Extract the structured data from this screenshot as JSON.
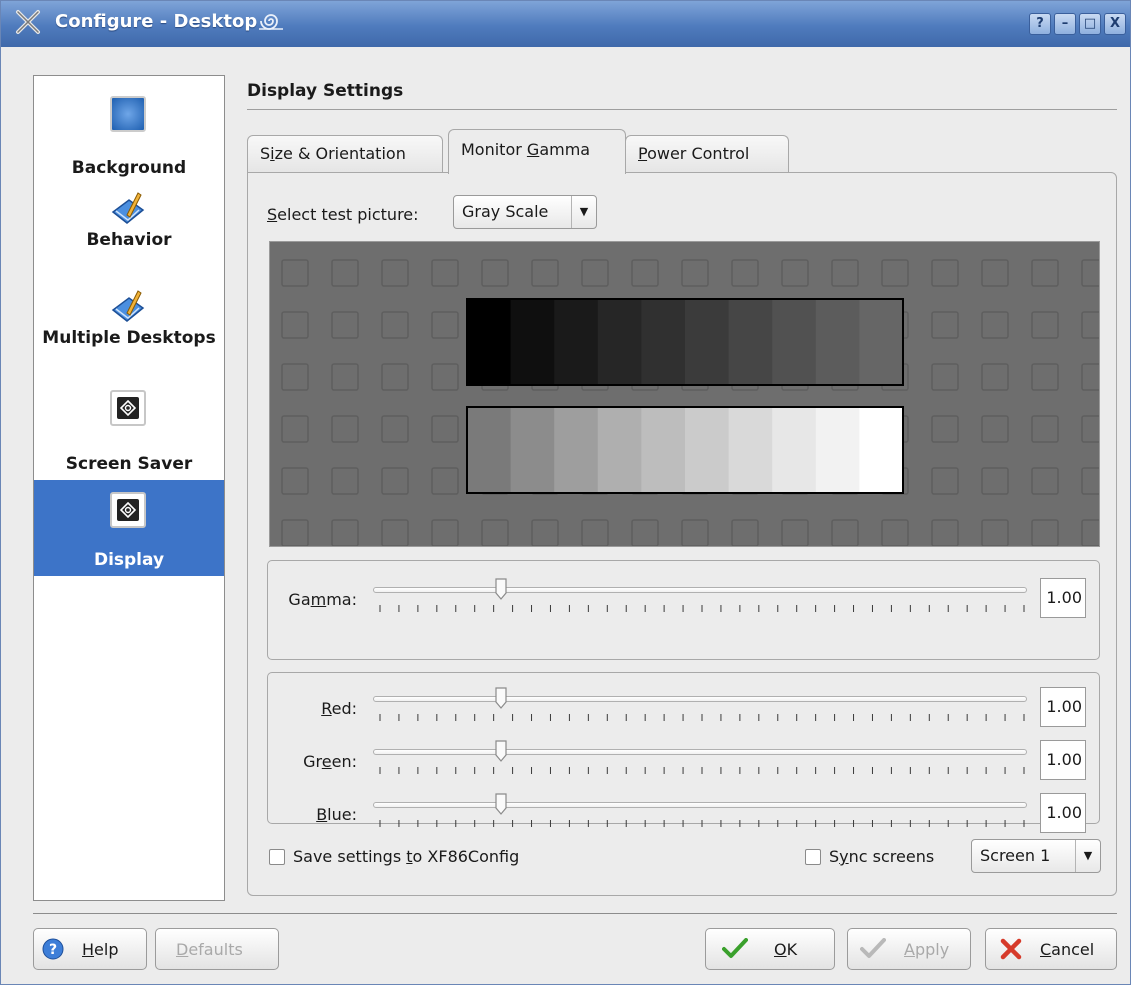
{
  "window": {
    "title": "Configure - Desktop"
  },
  "sidebar": {
    "items": [
      {
        "label": "Background",
        "icon": "background-icon",
        "selected": false
      },
      {
        "label": "Behavior",
        "icon": "behavior-icon",
        "selected": false
      },
      {
        "label": "Multiple Desktops",
        "icon": "multiple-desktops-icon",
        "selected": false
      },
      {
        "label": "Screen Saver",
        "icon": "screen-saver-icon",
        "selected": false
      },
      {
        "label": "Display",
        "icon": "display-icon",
        "selected": true
      }
    ]
  },
  "main": {
    "title": "Display Settings",
    "tabs": [
      {
        "pre": "S",
        "u": "i",
        "post": "ze & Orientation",
        "active": false
      },
      {
        "pre": "Monitor ",
        "u": "G",
        "post": "amma",
        "active": true
      },
      {
        "pre": "",
        "u": "P",
        "post": "ower Control",
        "active": false
      }
    ],
    "test_picture": {
      "label_u": "S",
      "label_rest": "elect test picture:",
      "value": "Gray Scale"
    },
    "gray_scale": {
      "top_row": [
        "#000000",
        "#0f0f0f",
        "#1a1a1a",
        "#262626",
        "#303030",
        "#3b3b3b",
        "#464646",
        "#515151",
        "#5c5c5c",
        "#666666"
      ],
      "bottom_row": [
        "#7a7a7a",
        "#8c8c8c",
        "#9e9e9e",
        "#afafaf",
        "#bdbdbd",
        "#cbcbcb",
        "#d9d9d9",
        "#e7e7e7",
        "#f2f2f2",
        "#ffffff"
      ]
    },
    "gamma": {
      "pre": "Ga",
      "u": "m",
      "post": "ma:",
      "value": "1.00"
    },
    "colors": [
      {
        "pre": "",
        "u": "R",
        "post": "ed:",
        "value": "1.00"
      },
      {
        "pre": "Gr",
        "u": "e",
        "post": "en:",
        "value": "1.00"
      },
      {
        "pre": "",
        "u": "B",
        "post": "lue:",
        "value": "1.00"
      }
    ],
    "save_settings": {
      "pre": "Save settings ",
      "u": "t",
      "post": "o XF86Config",
      "checked": false
    },
    "sync_screens": {
      "pre": "S",
      "u": "y",
      "post": "nc screens",
      "checked": false
    },
    "screen_select": {
      "value": "Screen 1"
    }
  },
  "buttons": {
    "help": {
      "u": "H",
      "post": "elp"
    },
    "defaults": {
      "u": "D",
      "post": "efaults"
    },
    "ok": {
      "u": "O",
      "post": "K"
    },
    "apply": {
      "u": "A",
      "post": "pply"
    },
    "cancel": {
      "u": "C",
      "post": "ancel"
    }
  },
  "colors": {
    "accent": "#3d74c8",
    "titlebar": "#4f7bbd"
  }
}
